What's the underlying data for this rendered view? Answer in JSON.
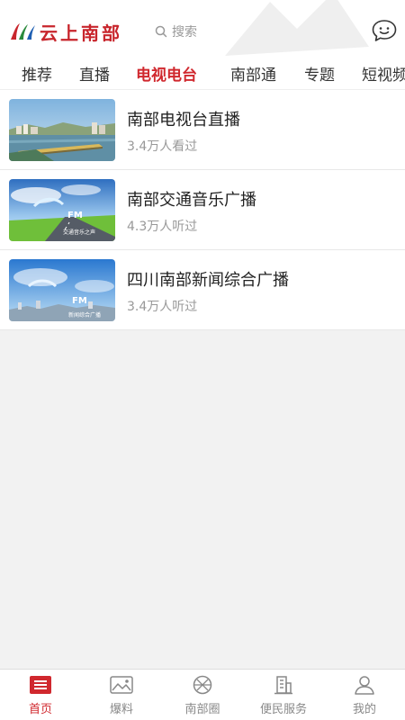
{
  "header": {
    "logo_text": "云上南部",
    "search_placeholder": "搜索"
  },
  "tabs": [
    {
      "label": "推荐"
    },
    {
      "label": "直播"
    },
    {
      "label": "电视电台",
      "active": true
    },
    {
      "label": "南部通"
    },
    {
      "label": "专题"
    },
    {
      "label": "短视频"
    }
  ],
  "list": [
    {
      "title": "南部电视台直播",
      "meta": "3.4万人看过"
    },
    {
      "title": "南部交通音乐广播",
      "meta": "4.3万人听过",
      "thumb_text": "交通音乐之声",
      "thumb_fm": "FM"
    },
    {
      "title": "四川南部新闻综合广播",
      "meta": "3.4万人听过",
      "thumb_text": "新闻综合广播",
      "thumb_fm": "FM"
    }
  ],
  "bottom_nav": [
    {
      "label": "首页",
      "icon": "home-icon",
      "active": true
    },
    {
      "label": "爆料",
      "icon": "image-icon"
    },
    {
      "label": "南部圈",
      "icon": "circle-icon"
    },
    {
      "label": "便民服务",
      "icon": "building-icon"
    },
    {
      "label": "我的",
      "icon": "user-icon"
    }
  ],
  "colors": {
    "accent": "#d0282e",
    "logo": "#c8252c",
    "muted": "#999999",
    "background": "#f2f2f2"
  }
}
